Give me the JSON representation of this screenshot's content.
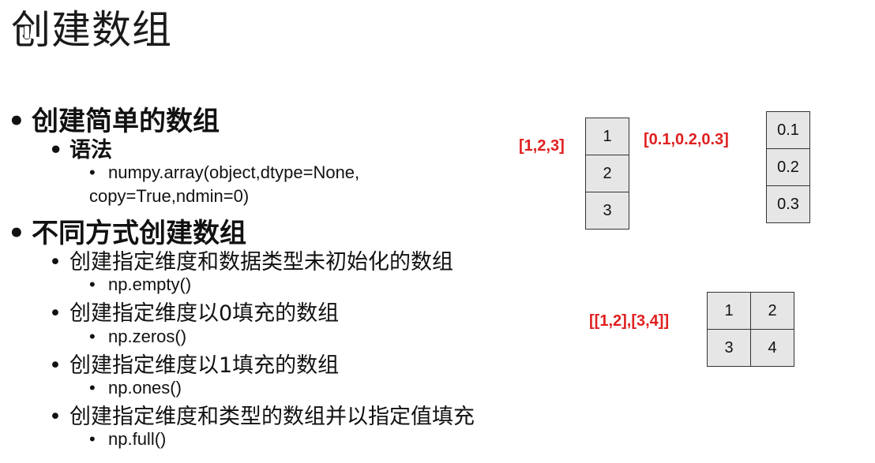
{
  "slide": {
    "title": "创建数组",
    "items": [
      {
        "bullet": "•",
        "text": "创建简单的数组"
      },
      {
        "bullet": "•",
        "text": "语法"
      },
      {
        "bullet": "•",
        "text": "numpy.array(object,dtype=None,"
      },
      {
        "text": "copy=True,ndmin=0)"
      },
      {
        "bullet": "•",
        "text": "不同方式创建数组"
      },
      {
        "bullet": "•",
        "text": "创建指定维度和数据类型未初始化的数组"
      },
      {
        "bullet": "•",
        "text": "np.empty()"
      },
      {
        "bullet": "•",
        "text": "创建指定维度以0填充的数组"
      },
      {
        "bullet": "•",
        "text": "np.zeros()"
      },
      {
        "bullet": "•",
        "text": "创建指定维度以1填充的数组"
      },
      {
        "bullet": "•",
        "text": "np.ones()"
      },
      {
        "bullet": "•",
        "text": "创建指定维度和类型的数组并以指定值填充"
      },
      {
        "bullet": "•",
        "text": "np.full()"
      }
    ]
  },
  "examples": {
    "a1_label": "[1,2,3]",
    "a1_cells": [
      "1",
      "2",
      "3"
    ],
    "a2_label": "[0.1,0.2,0.3]",
    "a2_cells": [
      "0.1",
      "0.2",
      "0.3"
    ],
    "a3_label": "[[1,2],[3,4]]",
    "a3_cells": [
      "1",
      "2",
      "3",
      "4"
    ]
  },
  "colors": {
    "accent_red": "#e02020",
    "cell_fill": "#e6e6e6"
  }
}
